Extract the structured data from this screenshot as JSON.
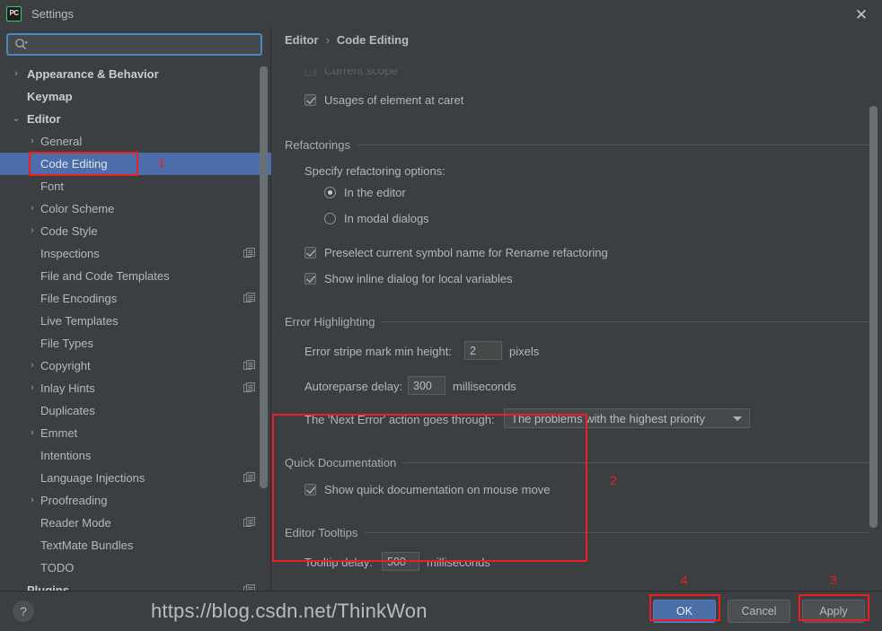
{
  "window": {
    "title": "Settings",
    "app_icon": "pycharm-icon",
    "app_icon_text": "PC",
    "close_icon": "close-icon",
    "close_glyph": "✕"
  },
  "search": {
    "value": "",
    "placeholder": "",
    "icon": "search-icon"
  },
  "sidebar": {
    "scrollbar": {
      "visible": true
    },
    "items": [
      {
        "label": "Appearance & Behavior",
        "depth": 0,
        "arrow": "›",
        "bold": true,
        "selected": false,
        "scope_icon": false
      },
      {
        "label": "Keymap",
        "depth": 0,
        "arrow": "",
        "bold": true,
        "selected": false,
        "scope_icon": false
      },
      {
        "label": "Editor",
        "depth": 0,
        "arrow": "⌄",
        "bold": true,
        "selected": false,
        "scope_icon": false
      },
      {
        "label": "General",
        "depth": 1,
        "arrow": "›",
        "bold": false,
        "selected": false,
        "scope_icon": false
      },
      {
        "label": "Code Editing",
        "depth": 1,
        "arrow": "",
        "bold": false,
        "selected": true,
        "scope_icon": false
      },
      {
        "label": "Font",
        "depth": 1,
        "arrow": "",
        "bold": false,
        "selected": false,
        "scope_icon": false
      },
      {
        "label": "Color Scheme",
        "depth": 1,
        "arrow": "›",
        "bold": false,
        "selected": false,
        "scope_icon": false
      },
      {
        "label": "Code Style",
        "depth": 1,
        "arrow": "›",
        "bold": false,
        "selected": false,
        "scope_icon": false
      },
      {
        "label": "Inspections",
        "depth": 1,
        "arrow": "",
        "bold": false,
        "selected": false,
        "scope_icon": true
      },
      {
        "label": "File and Code Templates",
        "depth": 1,
        "arrow": "",
        "bold": false,
        "selected": false,
        "scope_icon": false
      },
      {
        "label": "File Encodings",
        "depth": 1,
        "arrow": "",
        "bold": false,
        "selected": false,
        "scope_icon": true
      },
      {
        "label": "Live Templates",
        "depth": 1,
        "arrow": "",
        "bold": false,
        "selected": false,
        "scope_icon": false
      },
      {
        "label": "File Types",
        "depth": 1,
        "arrow": "",
        "bold": false,
        "selected": false,
        "scope_icon": false
      },
      {
        "label": "Copyright",
        "depth": 1,
        "arrow": "›",
        "bold": false,
        "selected": false,
        "scope_icon": true
      },
      {
        "label": "Inlay Hints",
        "depth": 1,
        "arrow": "›",
        "bold": false,
        "selected": false,
        "scope_icon": true
      },
      {
        "label": "Duplicates",
        "depth": 1,
        "arrow": "",
        "bold": false,
        "selected": false,
        "scope_icon": false
      },
      {
        "label": "Emmet",
        "depth": 1,
        "arrow": "›",
        "bold": false,
        "selected": false,
        "scope_icon": false
      },
      {
        "label": "Intentions",
        "depth": 1,
        "arrow": "",
        "bold": false,
        "selected": false,
        "scope_icon": false
      },
      {
        "label": "Language Injections",
        "depth": 1,
        "arrow": "",
        "bold": false,
        "selected": false,
        "scope_icon": true
      },
      {
        "label": "Proofreading",
        "depth": 1,
        "arrow": "›",
        "bold": false,
        "selected": false,
        "scope_icon": false
      },
      {
        "label": "Reader Mode",
        "depth": 1,
        "arrow": "",
        "bold": false,
        "selected": false,
        "scope_icon": true
      },
      {
        "label": "TextMate Bundles",
        "depth": 1,
        "arrow": "",
        "bold": false,
        "selected": false,
        "scope_icon": false
      },
      {
        "label": "TODO",
        "depth": 1,
        "arrow": "",
        "bold": false,
        "selected": false,
        "scope_icon": false
      },
      {
        "label": "Plugins",
        "depth": 0,
        "arrow": "",
        "bold": true,
        "selected": false,
        "scope_icon": true
      }
    ]
  },
  "breadcrumb": {
    "root": "Editor",
    "separator": "›",
    "current": "Code Editing"
  },
  "content": {
    "clipped_option_label": "Current scope",
    "usages_checkbox": {
      "label": "Usages of element at caret",
      "checked": true
    },
    "refactorings": {
      "section_title": "Refactorings",
      "specify_label": "Specify refactoring options:",
      "radios": [
        {
          "label": "In the editor",
          "checked": true
        },
        {
          "label": "In modal dialogs",
          "checked": false
        }
      ],
      "checkboxes": [
        {
          "label": "Preselect current symbol name for Rename refactoring",
          "checked": true
        },
        {
          "label": "Show inline dialog for local variables",
          "checked": true
        }
      ]
    },
    "error_highlighting": {
      "section_title": "Error Highlighting",
      "stripe_label": "Error stripe mark min height:",
      "stripe_value": "2",
      "stripe_unit": "pixels",
      "autoreparse_label": "Autoreparse delay:",
      "autoreparse_value": "300",
      "autoreparse_unit": "milliseconds",
      "next_error_label": "The 'Next Error' action goes through:",
      "next_error_value": "The problems with the highest priority"
    },
    "quick_documentation": {
      "section_title": "Quick Documentation",
      "checkbox": {
        "label": "Show quick documentation on mouse move",
        "checked": true
      }
    },
    "editor_tooltips": {
      "section_title": "Editor Tooltips",
      "delay_label": "Tooltip delay:",
      "delay_value": "500",
      "delay_unit": "milliseconds"
    }
  },
  "footer": {
    "help_glyph": "?",
    "ok_label": "OK",
    "cancel_label": "Cancel",
    "apply_label": "Apply"
  },
  "annotations": {
    "color": "#f01c21",
    "marks": [
      {
        "id": "1",
        "target": "code-editing-tree-item"
      },
      {
        "id": "2",
        "target": "quick-documentation-and-tooltips-group"
      },
      {
        "id": "3",
        "target": "apply-button"
      },
      {
        "id": "4",
        "target": "ok-button"
      }
    ]
  },
  "watermark": {
    "text": "https://blog.csdn.net/ThinkWon"
  }
}
